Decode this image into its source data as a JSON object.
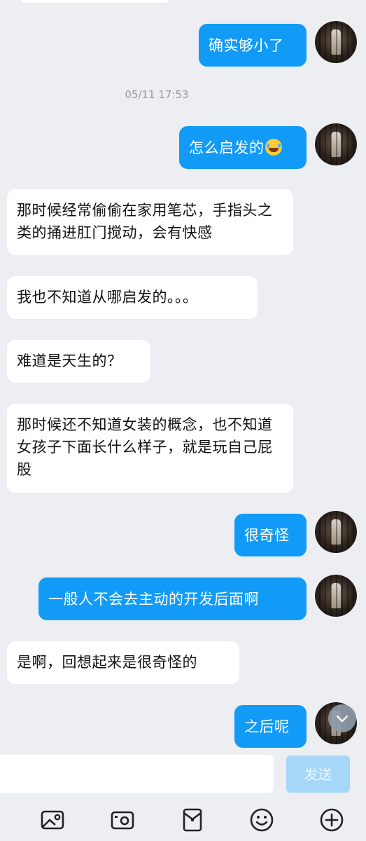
{
  "messages": [
    {
      "dir": "out",
      "text": "确实够小了"
    },
    {
      "dir": "time",
      "text": "05/11 17:53"
    },
    {
      "dir": "out",
      "text": "怎么启发的",
      "emoji": "laughing-crying-emoji"
    },
    {
      "dir": "in",
      "text": "那时候经常偷偷在家用笔芯，手指头之类的捅进肛门搅动，会有快感"
    },
    {
      "dir": "in",
      "text": "我也不知道从哪启发的。。。"
    },
    {
      "dir": "in",
      "text": "难道是天生的？"
    },
    {
      "dir": "in",
      "text": "那时候还不知道女装的概念，也不知道女孩子下面长什么样子，就是玩自己屁股"
    },
    {
      "dir": "out",
      "text": "很奇怪"
    },
    {
      "dir": "out",
      "text": "一般人不会去主动的开发后面啊"
    },
    {
      "dir": "in",
      "text": "是啊，回想起来是很奇怪的"
    },
    {
      "dir": "out",
      "text": "之后呢"
    }
  ],
  "input": {
    "value": "",
    "placeholder": ""
  },
  "send_label": "发送",
  "toolbar": [
    "image-icon",
    "camera-icon",
    "red-packet-icon",
    "emoji-icon",
    "plus-icon"
  ],
  "colors": {
    "outgoing": "#129bf6",
    "incoming": "#ffffff",
    "background": "#eceef2",
    "send_disabled": "#a6d6f8"
  }
}
